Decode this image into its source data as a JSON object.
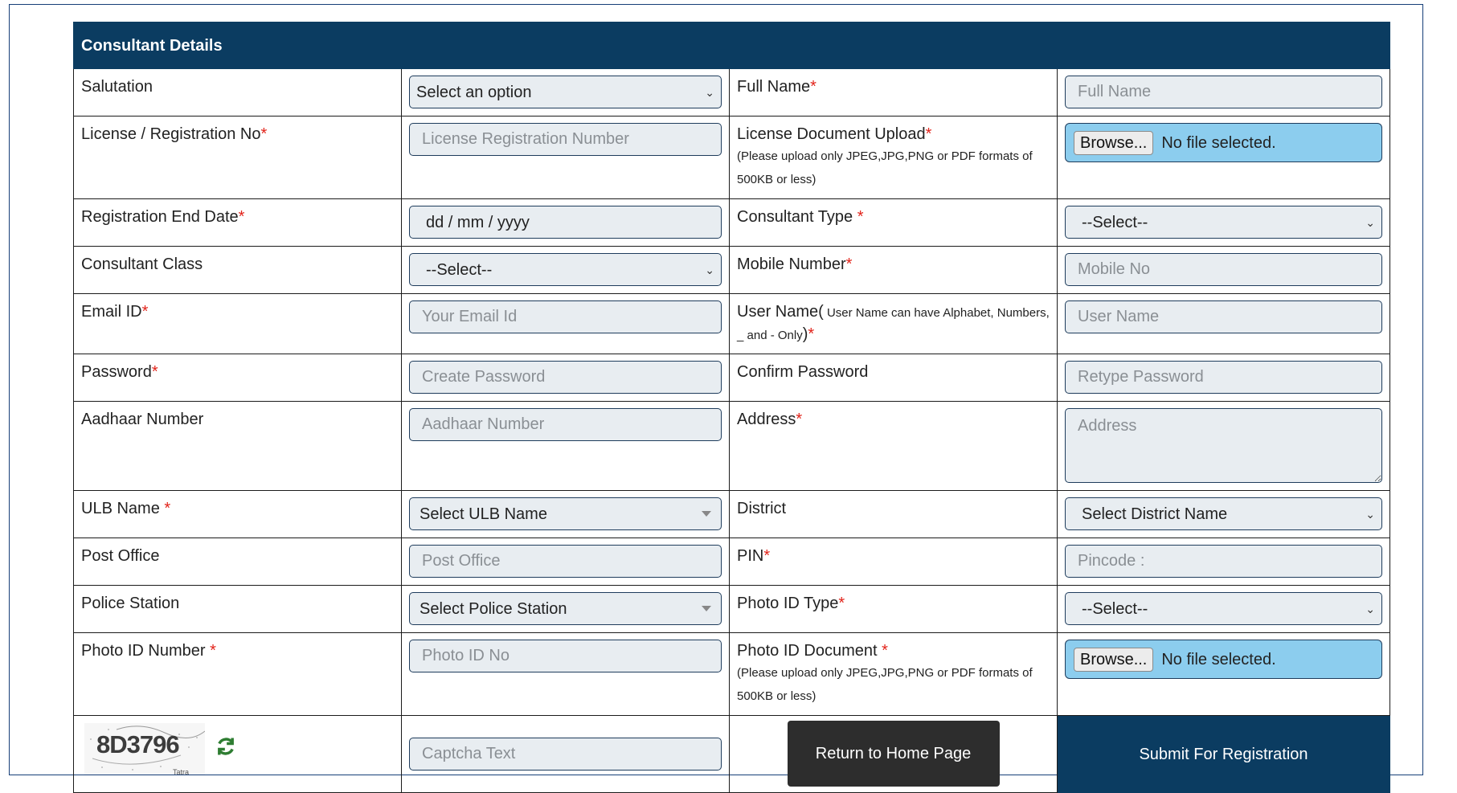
{
  "section": {
    "title": "Consultant Details"
  },
  "rows": {
    "salutation": {
      "label": "Salutation",
      "value": "Select an option"
    },
    "full_name": {
      "label": "Full Name",
      "req": "*",
      "placeholder": "Full Name"
    },
    "license": {
      "label": "License / Registration No",
      "req": "*",
      "placeholder": "License Registration Number"
    },
    "license_doc": {
      "label": "License Document Upload",
      "req": "*",
      "note": "(Please upload only JPEG,JPG,PNG or PDF formats of 500KB or less)",
      "browse": "Browse...",
      "status": "No file selected."
    },
    "reg_end_date": {
      "label": "Registration End Date",
      "req": "*",
      "placeholder": "dd / mm / yyyy"
    },
    "consultant_type": {
      "label": "Consultant Type ",
      "req": "*",
      "value": "--Select--"
    },
    "consultant_class": {
      "label": "Consultant Class",
      "value": "--Select--"
    },
    "mobile": {
      "label": "Mobile Number",
      "req": "*",
      "placeholder": "Mobile No"
    },
    "email": {
      "label": "Email ID",
      "req": "*",
      "placeholder": "Your Email Id"
    },
    "username": {
      "label": "User Name(",
      "note": " User Name can have Alphabet, Numbers, _ and - Only",
      "close": ")",
      "req": "*",
      "placeholder": "User Name"
    },
    "password": {
      "label": "Password",
      "req": "*",
      "placeholder": "Create Password"
    },
    "confirm_password": {
      "label": "Confirm Password",
      "placeholder": "Retype Password"
    },
    "aadhaar": {
      "label": "Aadhaar Number",
      "placeholder": "Aadhaar Number"
    },
    "address": {
      "label": "Address",
      "req": "*",
      "placeholder": "Address"
    },
    "ulb": {
      "label": "ULB Name ",
      "req": "*",
      "value": "Select ULB Name"
    },
    "district": {
      "label": "District",
      "value": "Select District Name"
    },
    "post_office": {
      "label": "Post Office",
      "placeholder": "Post Office"
    },
    "pin": {
      "label": "PIN",
      "req": "*",
      "placeholder": "Pincode :"
    },
    "police_station": {
      "label": "Police Station",
      "value": "Select Police Station"
    },
    "photo_id_type": {
      "label": "Photo ID Type",
      "req": "*",
      "value": "--Select--"
    },
    "photo_id_number": {
      "label": "Photo ID Number ",
      "req": "*",
      "placeholder": "Photo ID No"
    },
    "photo_id_doc": {
      "label": "Photo ID Document ",
      "req": "*",
      "note": "(Please upload only JPEG,JPG,PNG or PDF formats of 500KB or less)",
      "browse": "Browse...",
      "status": "No file selected."
    }
  },
  "captcha": {
    "code": "8D3796",
    "brand": "Tatra",
    "placeholder": "Captcha Text"
  },
  "actions": {
    "home": "Return to Home Page",
    "submit": "Submit For Registration"
  },
  "colors": {
    "header": "#0b3c61",
    "required": "#e2231a",
    "file_bg": "#8ccdee",
    "home_btn": "#2d2d2d"
  }
}
